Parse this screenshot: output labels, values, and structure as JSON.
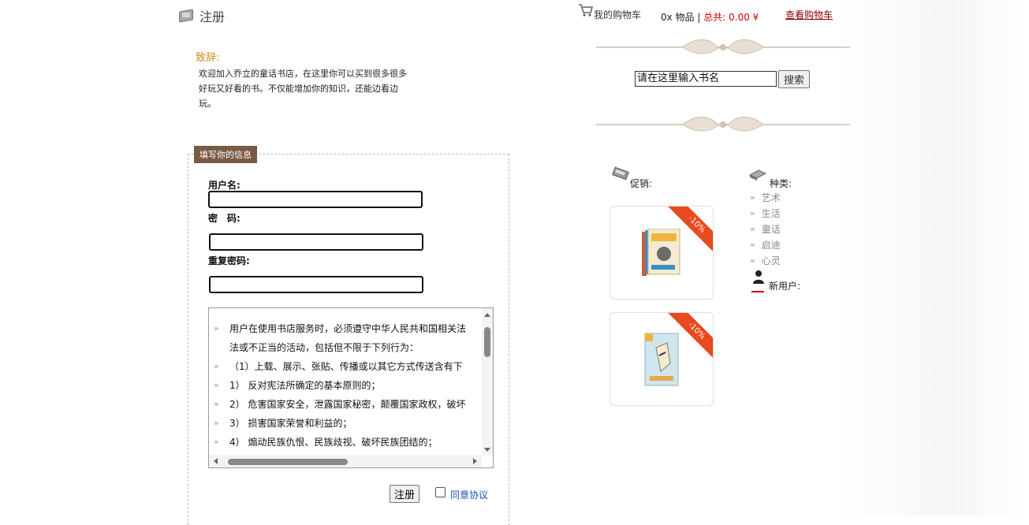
{
  "register": {
    "title": "注册",
    "greeting_heading": "致辞:",
    "greeting_text": "欢迎加入乔立的童话书店，在这里你可以买到很多很多好玩又好看的书。不仅能增加你的知识，还能边看边玩。",
    "legend": "填写你的信息",
    "username_label": "用户名:",
    "password_label": "密　码:",
    "confirm_label": "重复密码:",
    "username_value": "",
    "password_value": "",
    "confirm_value": "",
    "terms": [
      "用户在使用书店服务时，必须遵守中华人民共和国相关法",
      "法或不正当的活动，包括但不限于下列行为：",
      "（1）上载、展示、张贴、传播或以其它方式传送含有下",
      "1） 反对宪法所确定的基本原则的；",
      "2） 危害国家安全，泄露国家秘密，颠覆国家政权，破坏",
      "3） 损害国家荣誉和利益的；",
      "4） 煽动民族仇恨、民族歧视、破坏民族团结的；"
    ],
    "submit_label": "注册",
    "agree_label": "同意协议",
    "agree_checked": false
  },
  "header": {
    "cart_label": "我的购物车",
    "cart_count": "0x 物品",
    "cart_separator": "|",
    "cart_total": "总共: 0.00 ¥",
    "view_cart": "查看购物车",
    "search_value": "请在这里输入书名",
    "search_button": "搜索"
  },
  "promo": {
    "label": "促销:",
    "products": [
      {
        "discount": "-10%"
      },
      {
        "discount": "-10%"
      }
    ]
  },
  "categories": {
    "label": "种类:",
    "items": [
      "艺术",
      "生活",
      "童话",
      "启迪",
      "心灵"
    ]
  },
  "new_user": {
    "label": "新用户:"
  },
  "colors": {
    "brand_brown": "#7a5a45",
    "accent_red": "#e84b1e",
    "link_blue": "#1f4fb8"
  }
}
